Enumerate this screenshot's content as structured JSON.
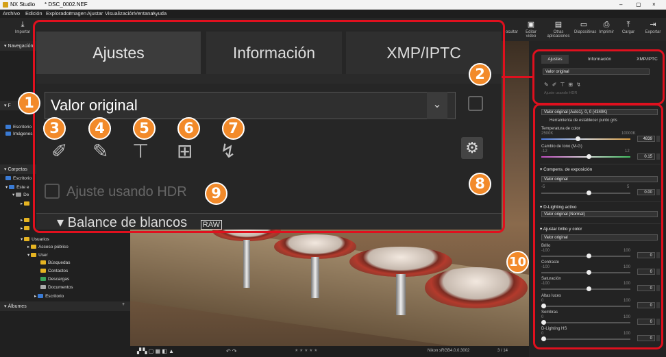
{
  "titlebar": {
    "app": "NX Studio",
    "file": "* DSC_0002.NEF",
    "min": "–",
    "max": "▢",
    "close": "×"
  },
  "menu": [
    "Archivo",
    "Edición",
    "Explorador",
    "Imagen",
    "Ajustar",
    "Visualización",
    "Ventana",
    "Ayuda"
  ],
  "toolbar": {
    "import": "Importar",
    "cut_left": "ocultar",
    "edit_video": "Editar vídeo",
    "other_apps": "Otras aplicaciones",
    "slides": "Diapositivas",
    "print": "Imprimir",
    "upload": "Cargar",
    "export": "Exportar"
  },
  "left": {
    "nav": "Navegación",
    "favs_head": "F",
    "favs": [
      {
        "label": "Escritorio"
      },
      {
        "label": "Imágenes"
      }
    ],
    "folders_head": "Carpetas",
    "tree": [
      "Escritorio",
      "Este e",
      "De",
      "Usuarios",
      "Acceso público",
      "User",
      "Búsquedas",
      "Contactos",
      "Descargas",
      "Documentos",
      "Escritorio"
    ],
    "albums": "Álbumes"
  },
  "right": {
    "tabs": [
      "Ajustes",
      "Información",
      "XMP/IPTC"
    ],
    "preset": "Valor original",
    "hdr": "Ajuste usando HDR",
    "wb_select": "Valor original (Auto1), 0, 0 (4340K)",
    "wb_tool": "Herramienta de establecer punto gris",
    "temp_label": "Temperatura de color",
    "temp_min": "2500K",
    "temp_max": "10000K",
    "temp_val": "4839",
    "tint_label": "Cambio de tono (M-G)",
    "tint_min": "-12",
    "tint_max": "12",
    "tint_val": "0.15",
    "exposure_head": "Compens. de exposición",
    "exposure_sel": "Valor original",
    "exposure_min": "-5",
    "exposure_max": "5",
    "exposure_val": "0.00",
    "dlight_head": "D-Lighting activo",
    "dlight_sel": "Valor original (Normal)",
    "bright_head": "Ajustar brillo y color",
    "bright_sel": "Valor original",
    "sliders": [
      {
        "name": "Brillo",
        "min": "-100",
        "max": "100",
        "val": "0"
      },
      {
        "name": "Contraste",
        "min": "-100",
        "max": "100",
        "val": "0"
      },
      {
        "name": "Saturación",
        "min": "-100",
        "max": "100",
        "val": "0"
      },
      {
        "name": "Altas luces",
        "min": "0",
        "max": "100",
        "val": "0"
      },
      {
        "name": "Sombras",
        "min": "0",
        "max": "100",
        "val": "0"
      },
      {
        "name": "D-Lighting HS",
        "min": "0",
        "max": "100",
        "val": "0"
      }
    ]
  },
  "bottom": {
    "profile": "Nikon sRGB4.0.0.3002",
    "page": "3 / 14",
    "rating": "★ ★ ★ ★ ★"
  },
  "zoom": {
    "tabs": [
      "Ajustes",
      "Información",
      "XMP/IPTC"
    ],
    "preset": "Valor original",
    "hdr": "Ajuste usando HDR",
    "section": "Balance de blancos",
    "raw": "RAW"
  },
  "callouts": [
    "1",
    "2",
    "3",
    "4",
    "5",
    "6",
    "7",
    "8",
    "9",
    "10"
  ]
}
